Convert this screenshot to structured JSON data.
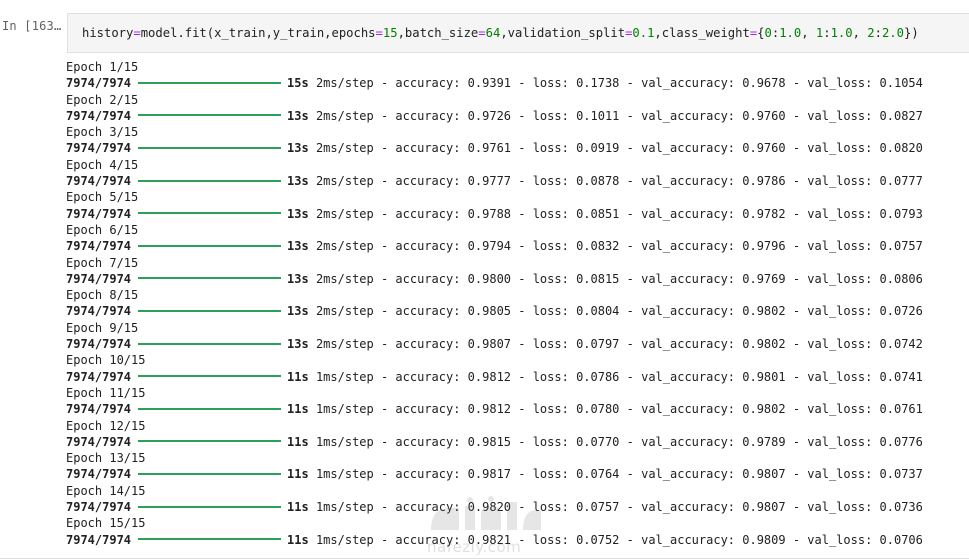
{
  "cell": {
    "prompt": "In [163…",
    "code": {
      "parts": [
        {
          "t": "history",
          "k": "punc"
        },
        {
          "t": "=",
          "k": "op"
        },
        {
          "t": "model.fit(x_train,y_train,epochs",
          "k": "punc"
        },
        {
          "t": "=",
          "k": "op"
        },
        {
          "t": "15",
          "k": "num"
        },
        {
          "t": ",batch_size",
          "k": "punc"
        },
        {
          "t": "=",
          "k": "op"
        },
        {
          "t": "64",
          "k": "num"
        },
        {
          "t": ",validation_split",
          "k": "punc"
        },
        {
          "t": "=",
          "k": "op"
        },
        {
          "t": "0.1",
          "k": "num"
        },
        {
          "t": ",class_weight",
          "k": "punc"
        },
        {
          "t": "=",
          "k": "op"
        },
        {
          "t": "{",
          "k": "punc"
        },
        {
          "t": "0",
          "k": "num"
        },
        {
          "t": ":",
          "k": "punc"
        },
        {
          "t": "1.0",
          "k": "num"
        },
        {
          "t": ", ",
          "k": "punc"
        },
        {
          "t": "1",
          "k": "num"
        },
        {
          "t": ":",
          "k": "punc"
        },
        {
          "t": "1.0",
          "k": "num"
        },
        {
          "t": ", ",
          "k": "punc"
        },
        {
          "t": "2",
          "k": "num"
        },
        {
          "t": ":",
          "k": "punc"
        },
        {
          "t": "2.0",
          "k": "num"
        },
        {
          "t": "})",
          "k": "punc"
        }
      ]
    }
  },
  "training": {
    "steps": "7974/7974",
    "epochs": [
      {
        "label": "Epoch 1/15",
        "time": "15s",
        "step": "2ms/step",
        "accuracy": "0.9391",
        "loss": "0.1738",
        "val_accuracy": "0.9678",
        "val_loss": "0.1054"
      },
      {
        "label": "Epoch 2/15",
        "time": "13s",
        "step": "2ms/step",
        "accuracy": "0.9726",
        "loss": "0.1011",
        "val_accuracy": "0.9760",
        "val_loss": "0.0827"
      },
      {
        "label": "Epoch 3/15",
        "time": "13s",
        "step": "2ms/step",
        "accuracy": "0.9761",
        "loss": "0.0919",
        "val_accuracy": "0.9760",
        "val_loss": "0.0820"
      },
      {
        "label": "Epoch 4/15",
        "time": "13s",
        "step": "2ms/step",
        "accuracy": "0.9777",
        "loss": "0.0878",
        "val_accuracy": "0.9786",
        "val_loss": "0.0777"
      },
      {
        "label": "Epoch 5/15",
        "time": "13s",
        "step": "2ms/step",
        "accuracy": "0.9788",
        "loss": "0.0851",
        "val_accuracy": "0.9782",
        "val_loss": "0.0793"
      },
      {
        "label": "Epoch 6/15",
        "time": "13s",
        "step": "2ms/step",
        "accuracy": "0.9794",
        "loss": "0.0832",
        "val_accuracy": "0.9796",
        "val_loss": "0.0757"
      },
      {
        "label": "Epoch 7/15",
        "time": "13s",
        "step": "2ms/step",
        "accuracy": "0.9800",
        "loss": "0.0815",
        "val_accuracy": "0.9769",
        "val_loss": "0.0806"
      },
      {
        "label": "Epoch 8/15",
        "time": "13s",
        "step": "2ms/step",
        "accuracy": "0.9805",
        "loss": "0.0804",
        "val_accuracy": "0.9802",
        "val_loss": "0.0726"
      },
      {
        "label": "Epoch 9/15",
        "time": "13s",
        "step": "2ms/step",
        "accuracy": "0.9807",
        "loss": "0.0797",
        "val_accuracy": "0.9802",
        "val_loss": "0.0742"
      },
      {
        "label": "Epoch 10/15",
        "time": "11s",
        "step": "1ms/step",
        "accuracy": "0.9812",
        "loss": "0.0786",
        "val_accuracy": "0.9801",
        "val_loss": "0.0741"
      },
      {
        "label": "Epoch 11/15",
        "time": "11s",
        "step": "1ms/step",
        "accuracy": "0.9812",
        "loss": "0.0780",
        "val_accuracy": "0.9802",
        "val_loss": "0.0761"
      },
      {
        "label": "Epoch 12/15",
        "time": "11s",
        "step": "1ms/step",
        "accuracy": "0.9815",
        "loss": "0.0770",
        "val_accuracy": "0.9789",
        "val_loss": "0.0776"
      },
      {
        "label": "Epoch 13/15",
        "time": "11s",
        "step": "1ms/step",
        "accuracy": "0.9817",
        "loss": "0.0764",
        "val_accuracy": "0.9807",
        "val_loss": "0.0737"
      },
      {
        "label": "Epoch 14/15",
        "time": "11s",
        "step": "1ms/step",
        "accuracy": "0.9820",
        "loss": "0.0757",
        "val_accuracy": "0.9807",
        "val_loss": "0.0736"
      },
      {
        "label": "Epoch 15/15",
        "time": "11s",
        "step": "1ms/step",
        "accuracy": "0.9821",
        "loss": "0.0752",
        "val_accuracy": "0.9809",
        "val_loss": "0.0706"
      }
    ]
  },
  "watermark": {
    "text": "nafezly.com"
  },
  "colors": {
    "progress_bar": "#2e9e58",
    "code_operator": "#aa22ff",
    "code_number": "#008000",
    "input_bg": "#f5f5f5"
  }
}
